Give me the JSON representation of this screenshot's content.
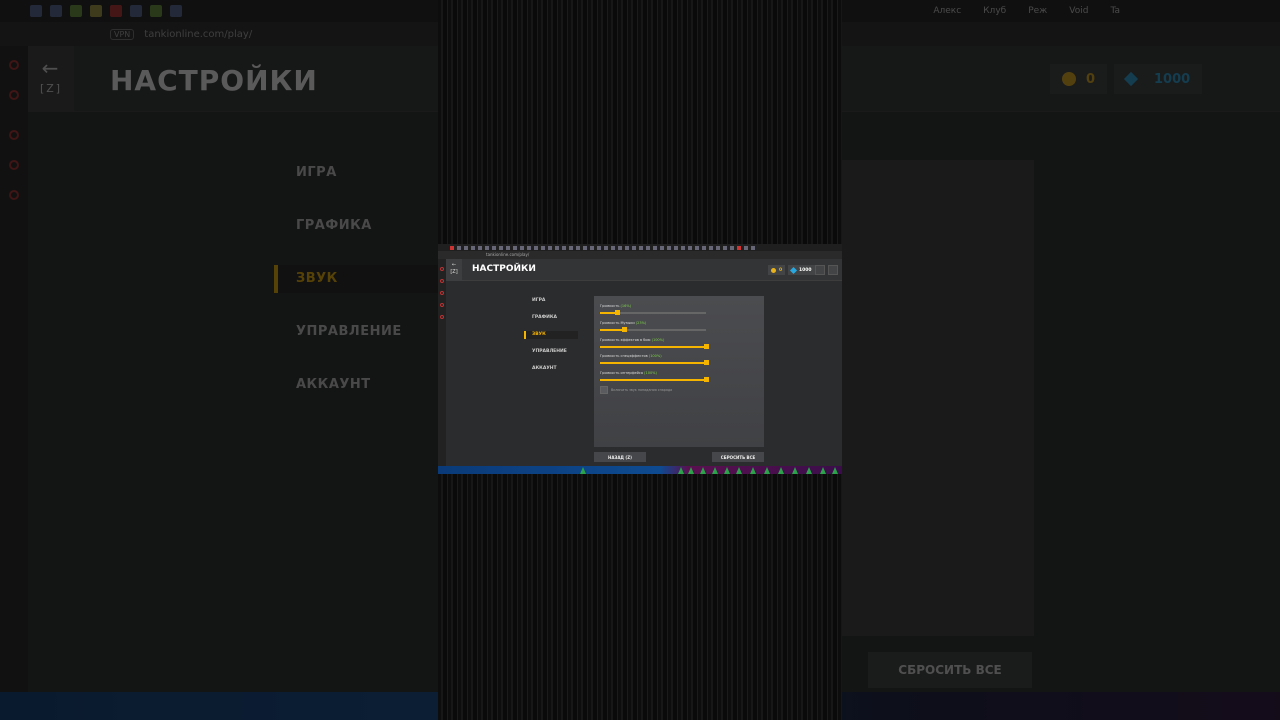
{
  "browser": {
    "url": "tankionline.com/play/",
    "url_badge": "VPN",
    "tabs": [
      "Алекс",
      "Клуб",
      "Реж",
      "Void",
      "Ta"
    ]
  },
  "page": {
    "title": "НАСТРОЙКИ",
    "back_key": "[Z]",
    "crystals": "0",
    "diamonds": "1000",
    "menu": [
      "ИГРА",
      "ГРАФИКА",
      "ЗВУК",
      "УПРАВЛЕНИЕ",
      "АККАУНТ"
    ],
    "active_menu": "ЗВУК",
    "reset_label": "СБРОСИТЬ ВСЕ"
  },
  "inner": {
    "url": "tankionline.com/play/",
    "title": "НАСТРОЙКИ",
    "back_key": "[Z]",
    "crystals": "0",
    "diamonds": "1000",
    "menu": [
      "ИГРА",
      "ГРАФИКА",
      "ЗВУК",
      "УПРАВЛЕНИЕ",
      "АККАУНТ"
    ],
    "sliders": [
      {
        "label": "Громкость",
        "pct": "(16%)",
        "value": 0.16
      },
      {
        "label": "Громкость Музыки",
        "pct": "(23%)",
        "value": 0.23
      },
      {
        "label": "Громкость эффектов в бою",
        "pct": "(100%)",
        "value": 1.0
      },
      {
        "label": "Громкость спецэффектов",
        "pct": "(100%)",
        "value": 1.0
      },
      {
        "label": "Громкость интерфейса",
        "pct": "(100%)",
        "value": 1.0
      }
    ],
    "checkbox_label": "Включить звук попадания снаряда",
    "back_button": "НАЗАД (Z)",
    "reset_button": "СБРОСИТЬ ВСЕ"
  },
  "colors": {
    "accent": "#f5b400",
    "percent_green": "#7fd44a",
    "diamond": "#29a8e0"
  }
}
